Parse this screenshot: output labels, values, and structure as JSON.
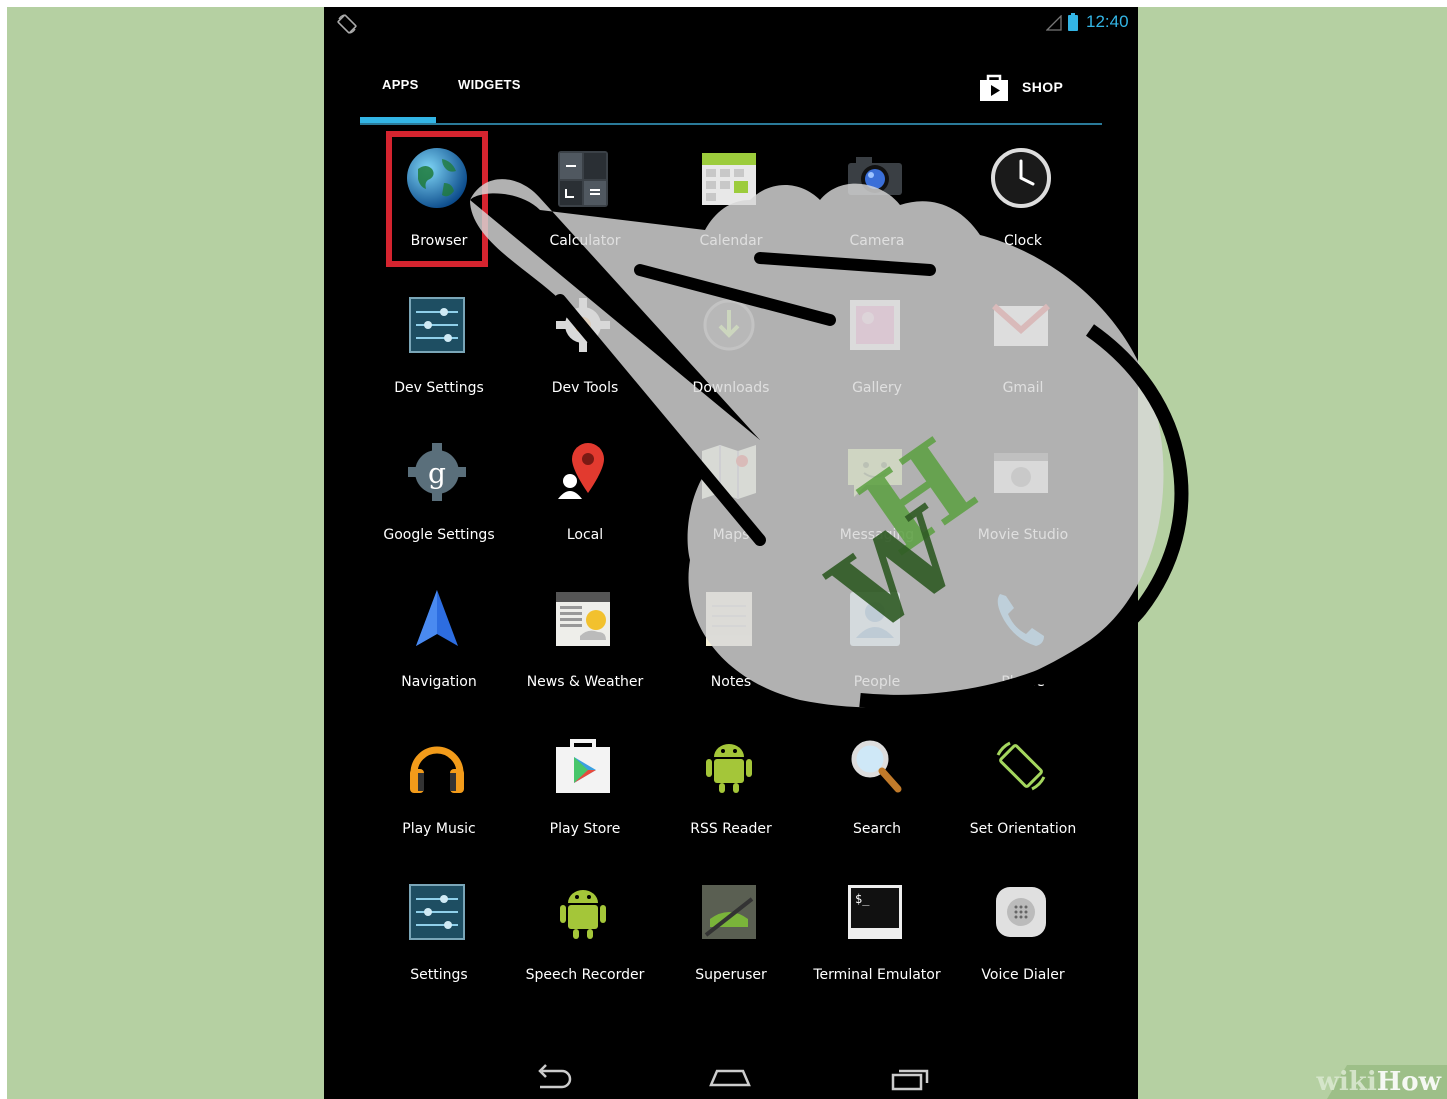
{
  "statusbar": {
    "time": "12:40"
  },
  "tabs": {
    "apps": "APPS",
    "widgets": "WIDGETS",
    "shop": "SHOP"
  },
  "apps": [
    {
      "label": "Browser",
      "icon": "globe-icon"
    },
    {
      "label": "Calculator",
      "icon": "calculator-icon"
    },
    {
      "label": "Calendar",
      "icon": "calendar-icon"
    },
    {
      "label": "Camera",
      "icon": "camera-icon"
    },
    {
      "label": "Clock",
      "icon": "clock-icon"
    },
    {
      "label": "Dev Settings",
      "icon": "dev-settings-icon"
    },
    {
      "label": "Dev Tools",
      "icon": "gear-icon"
    },
    {
      "label": "Downloads",
      "icon": "download-icon"
    },
    {
      "label": "Gallery",
      "icon": "gallery-icon"
    },
    {
      "label": "Gmail",
      "icon": "gmail-icon"
    },
    {
      "label": "Google Settings",
      "icon": "google-settings-icon"
    },
    {
      "label": "Local",
      "icon": "map-pin-icon"
    },
    {
      "label": "Maps",
      "icon": "maps-icon"
    },
    {
      "label": "Messaging",
      "icon": "messaging-icon"
    },
    {
      "label": "Movie Studio",
      "icon": "movie-studio-icon"
    },
    {
      "label": "Navigation",
      "icon": "navigation-arrow-icon"
    },
    {
      "label": "News & Weather",
      "icon": "newspaper-icon"
    },
    {
      "label": "Notes",
      "icon": "notes-icon"
    },
    {
      "label": "People",
      "icon": "contacts-icon"
    },
    {
      "label": "Phone",
      "icon": "phone-icon"
    },
    {
      "label": "Play Music",
      "icon": "headphones-icon"
    },
    {
      "label": "Play Store",
      "icon": "play-store-icon"
    },
    {
      "label": "RSS Reader",
      "icon": "android-icon"
    },
    {
      "label": "Search",
      "icon": "magnifier-icon"
    },
    {
      "label": "Set Orientation",
      "icon": "orientation-icon"
    },
    {
      "label": "Settings",
      "icon": "settings-icon"
    },
    {
      "label": "Speech Recorder",
      "icon": "android-icon"
    },
    {
      "label": "Superuser",
      "icon": "superuser-icon"
    },
    {
      "label": "Terminal Emulator",
      "icon": "terminal-icon"
    },
    {
      "label": "Voice Dialer",
      "icon": "voice-dialer-icon"
    }
  ],
  "watermark": {
    "text_a": "wiki",
    "text_b": "How"
  },
  "colors": {
    "accent": "#33b5e5",
    "highlight": "#d5242f",
    "background": "#b5d0a2"
  }
}
